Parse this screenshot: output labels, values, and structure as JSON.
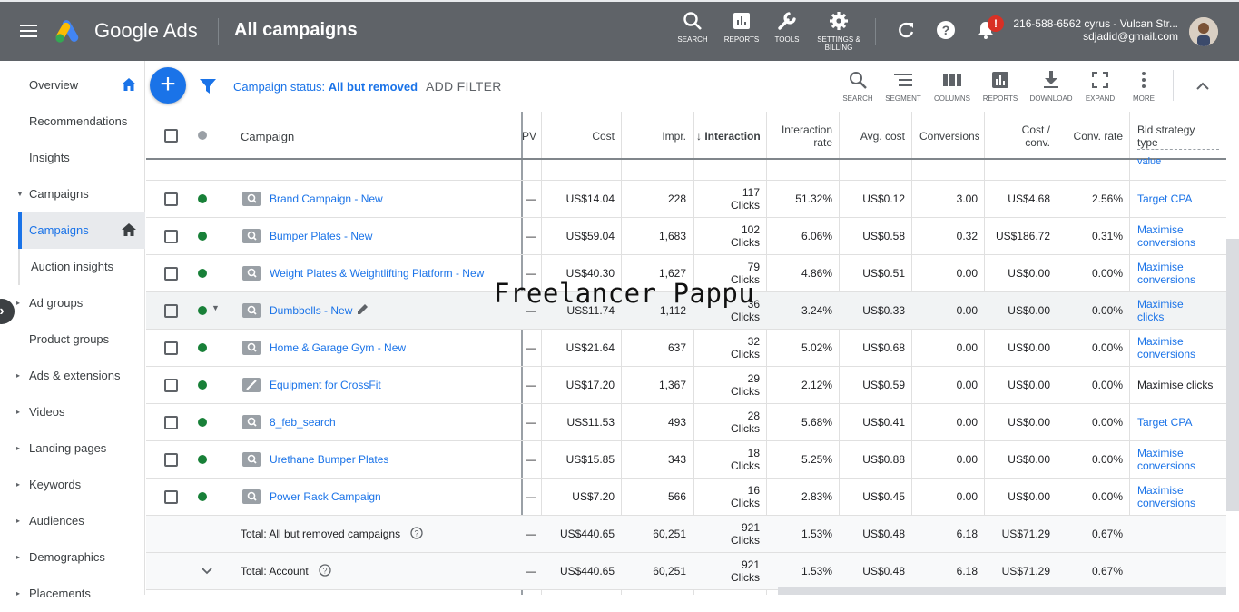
{
  "topbar": {
    "brand": "Google Ads",
    "page_title": "All campaigns",
    "tools": [
      {
        "icon": "search-icon",
        "label": "SEARCH"
      },
      {
        "icon": "reports-icon",
        "label": "REPORTS"
      },
      {
        "icon": "wrench-icon",
        "label": "TOOLS"
      },
      {
        "icon": "gear-icon",
        "label": "SETTINGS &",
        "label2": "BILLING"
      }
    ],
    "notification_badge": "!",
    "account_line1": "216-588-6562 cyrus - Vulcan Str...",
    "account_line2": "sdjadid@gmail.com"
  },
  "sidebar": {
    "items": [
      {
        "label": "Overview"
      },
      {
        "label": "Recommendations"
      },
      {
        "label": "Insights"
      },
      {
        "label": "Campaigns"
      },
      {
        "label": "Campaigns"
      },
      {
        "label": "Auction insights"
      },
      {
        "label": "Ad groups"
      },
      {
        "label": "Product groups"
      },
      {
        "label": "Ads & extensions"
      },
      {
        "label": "Videos"
      },
      {
        "label": "Landing pages"
      },
      {
        "label": "Keywords"
      },
      {
        "label": "Audiences"
      },
      {
        "label": "Demographics"
      },
      {
        "label": "Placements"
      }
    ]
  },
  "toolbar": {
    "fab": "+",
    "filter_prefix": "Campaign status: ",
    "filter_value": "All but removed",
    "add_filter": "ADD FILTER",
    "tools": [
      {
        "icon": "search-icon",
        "label": "SEARCH"
      },
      {
        "icon": "segment-icon",
        "label": "SEGMENT"
      },
      {
        "icon": "columns-icon",
        "label": "COLUMNS"
      },
      {
        "icon": "reports-icon",
        "label": "REPORTS"
      },
      {
        "icon": "download-icon",
        "label": "DOWNLOAD"
      },
      {
        "icon": "expand-icon",
        "label": "EXPAND"
      },
      {
        "icon": "more-icon",
        "label": "MORE"
      }
    ]
  },
  "table": {
    "headers": {
      "campaign": "Campaign",
      "pv": "PV",
      "cost": "Cost",
      "impr": "Impr.",
      "interactions": "Interactions",
      "interaction_rate_1": "Interaction",
      "interaction_rate_2": "rate",
      "avg_cost": "Avg. cost",
      "conversions": "Conversions",
      "cost_conv_1": "Cost /",
      "cost_conv_2": "conv.",
      "conv_rate": "Conv. rate",
      "bid_1": "Bid strategy",
      "bid_2": "type",
      "partial_above": "value"
    },
    "rows": [
      {
        "name": "Brand Campaign - New",
        "pv": "—",
        "cost": "US$14.04",
        "impr": "228",
        "int": "117",
        "int_unit": "Clicks",
        "rate": "51.32%",
        "avg": "US$0.12",
        "conv": "3.00",
        "cpc": "US$4.68",
        "crate": "2.56%",
        "bid1": "Target CPA",
        "bid2": "",
        "bid_link": true
      },
      {
        "name": "Bumper Plates - New",
        "pv": "—",
        "cost": "US$59.04",
        "impr": "1,683",
        "int": "102",
        "int_unit": "Clicks",
        "rate": "6.06%",
        "avg": "US$0.58",
        "conv": "0.32",
        "cpc": "US$186.72",
        "crate": "0.31%",
        "bid1": "Maximise",
        "bid2": "conversions",
        "bid_link": true
      },
      {
        "name": "Weight Plates & Weightlifting Platform - New",
        "pv": "—",
        "cost": "US$40.30",
        "impr": "1,627",
        "int": "79",
        "int_unit": "Clicks",
        "rate": "4.86%",
        "avg": "US$0.51",
        "conv": "0.00",
        "cpc": "US$0.00",
        "crate": "0.00%",
        "bid1": "Maximise",
        "bid2": "conversions",
        "bid_link": true
      },
      {
        "name": "Dumbbells - New",
        "pv": "—",
        "cost": "US$11.74",
        "impr": "1,112",
        "int": "36",
        "int_unit": "Clicks",
        "rate": "3.24%",
        "avg": "US$0.33",
        "conv": "0.00",
        "cpc": "US$0.00",
        "crate": "0.00%",
        "bid1": "Maximise",
        "bid2": "clicks",
        "bid_link": true
      },
      {
        "name": "Home & Garage Gym - New",
        "pv": "—",
        "cost": "US$21.64",
        "impr": "637",
        "int": "32",
        "int_unit": "Clicks",
        "rate": "5.02%",
        "avg": "US$0.68",
        "conv": "0.00",
        "cpc": "US$0.00",
        "crate": "0.00%",
        "bid1": "Maximise",
        "bid2": "conversions",
        "bid_link": true
      },
      {
        "name": "Equipment for CrossFit",
        "pv": "—",
        "cost": "US$17.20",
        "impr": "1,367",
        "int": "29",
        "int_unit": "Clicks",
        "rate": "2.12%",
        "avg": "US$0.59",
        "conv": "0.00",
        "cpc": "US$0.00",
        "crate": "0.00%",
        "bid1": "Maximise clicks",
        "bid2": "",
        "bid_link": false
      },
      {
        "name": "8_feb_search",
        "pv": "—",
        "cost": "US$11.53",
        "impr": "493",
        "int": "28",
        "int_unit": "Clicks",
        "rate": "5.68%",
        "avg": "US$0.41",
        "conv": "0.00",
        "cpc": "US$0.00",
        "crate": "0.00%",
        "bid1": "Target CPA",
        "bid2": "",
        "bid_link": true
      },
      {
        "name": "Urethane Bumper Plates",
        "pv": "—",
        "cost": "US$15.85",
        "impr": "343",
        "int": "18",
        "int_unit": "Clicks",
        "rate": "5.25%",
        "avg": "US$0.88",
        "conv": "0.00",
        "cpc": "US$0.00",
        "crate": "0.00%",
        "bid1": "Maximise",
        "bid2": "conversions",
        "bid_link": true
      },
      {
        "name": "Power Rack Campaign",
        "pv": "—",
        "cost": "US$7.20",
        "impr": "566",
        "int": "16",
        "int_unit": "Clicks",
        "rate": "2.83%",
        "avg": "US$0.45",
        "conv": "0.00",
        "cpc": "US$0.00",
        "crate": "0.00%",
        "bid1": "Maximise",
        "bid2": "conversions",
        "bid_link": true
      }
    ],
    "totals": [
      {
        "name": "Total: All but removed campaigns",
        "pv": "—",
        "cost": "US$440.65",
        "impr": "60,251",
        "int": "921",
        "int_unit": "Clicks",
        "rate": "1.53%",
        "avg": "US$0.48",
        "conv": "6.18",
        "cpc": "US$71.29",
        "crate": "0.67%"
      },
      {
        "name": "Total: Account",
        "pv": "—",
        "cost": "US$440.65",
        "impr": "60,251",
        "int": "921",
        "int_unit": "Clicks",
        "rate": "1.53%",
        "avg": "US$0.48",
        "conv": "6.18",
        "cpc": "US$71.29",
        "crate": "0.67%"
      }
    ]
  },
  "watermark": "Freelancer Pappu",
  "colors": {
    "topbar": "#5f6368",
    "accent": "#1a73e8",
    "enabled": "#188038",
    "badge": "#d93025"
  }
}
